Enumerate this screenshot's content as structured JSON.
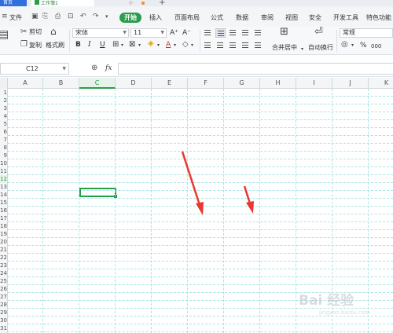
{
  "titlebar": {
    "home_tab": "首页",
    "book_tab": "工作簿1",
    "pin_icon": "pin-icon",
    "new_tab_label": "+"
  },
  "menu": {
    "file": "文件",
    "items": [
      "开始",
      "插入",
      "页面布局",
      "公式",
      "数据",
      "审阅",
      "视图",
      "安全",
      "开发工具",
      "特色功能"
    ],
    "active": "开始",
    "accent_color": "#2a9d4b"
  },
  "ribbon": {
    "cut": "剪切",
    "copy": "复制",
    "format_painter": "格式刷",
    "font_name": "宋体",
    "font_size": "11",
    "bold": "B",
    "italic": "I",
    "underline": "U",
    "font_color_letter": "A",
    "grow_font": "A⁺",
    "shrink_font": "A⁻",
    "merge_center": "合并居中",
    "wrap_text": "自动换行",
    "number_format": "常规",
    "percent": "%",
    "thousands": "000"
  },
  "formula_bar": {
    "cell_ref": "C12",
    "fx": "fx",
    "value": ""
  },
  "grid": {
    "columns": [
      "A",
      "B",
      "C",
      "D",
      "E",
      "F",
      "G",
      "H",
      "I",
      "J",
      "K"
    ],
    "selected_column": "C",
    "rows": [
      "1",
      "2",
      "3",
      "4",
      "5",
      "6",
      "7",
      "8",
      "9",
      "10",
      "11",
      "12",
      "13",
      "14",
      "15",
      "16",
      "17",
      "18",
      "19",
      "20",
      "21",
      "22",
      "23",
      "24",
      "25",
      "26",
      "27",
      "28",
      "29",
      "30",
      "31"
    ],
    "selected_row": "12",
    "gridline_color": "#a8e4e6"
  },
  "watermark": {
    "text": "Bai 经验",
    "sub": "jingyan.baidu.com"
  },
  "annotations": {
    "arrow_color": "#e8382f"
  }
}
